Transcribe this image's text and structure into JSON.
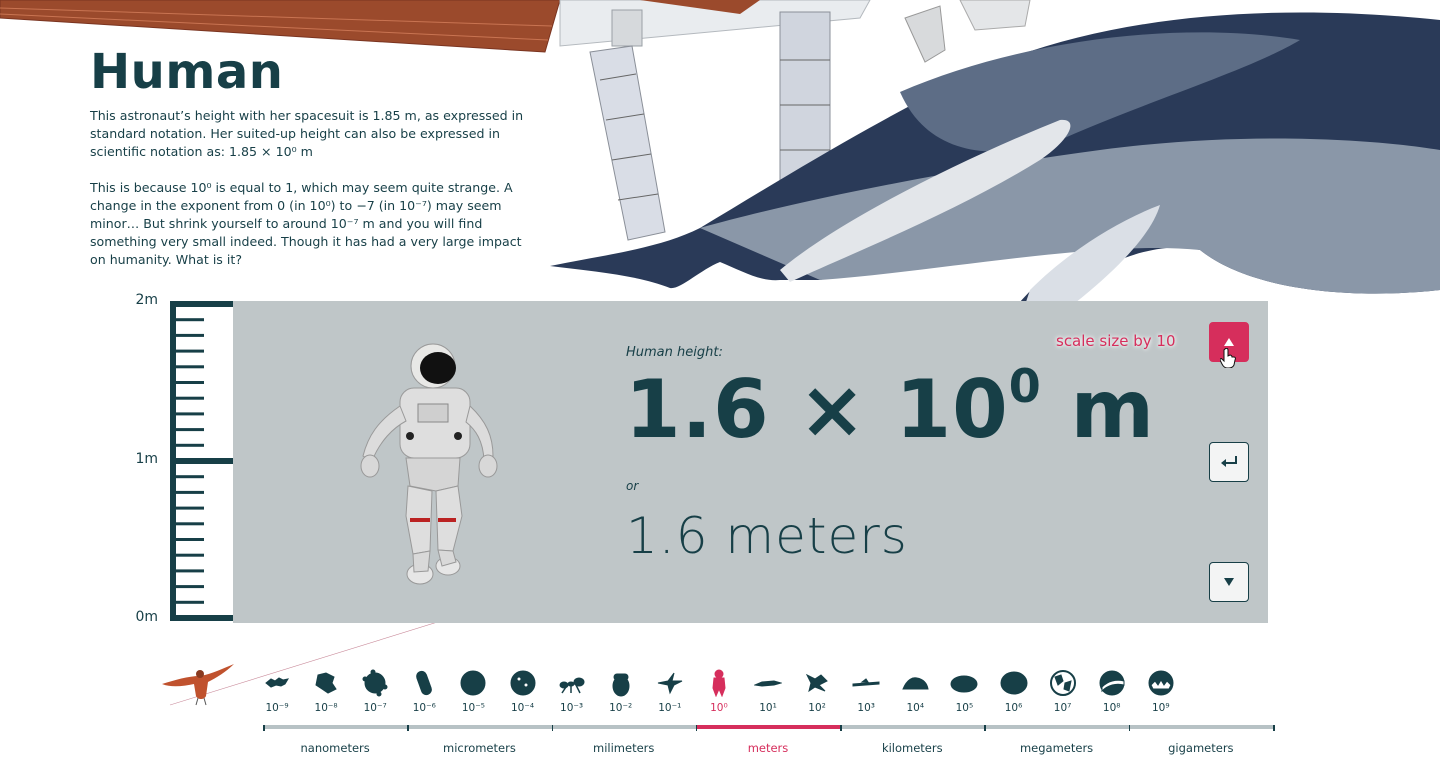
{
  "page": {
    "title": "Human",
    "intro_paragraphs": [
      "This astronaut’s height with her spacesuit is 1.85 m, as expressed in standard notation. Her suited-up height can also be expressed in scientific notation as: 1.85 × 10⁰ m",
      "This is because 10⁰ is equal to 1, which may seem quite strange. A change in the exponent from 0 (in 10⁰) to −7 (in 10⁻⁷) may seem minor… But shrink yourself to around 10⁻⁷ m and you will find something very small indeed. Though it has had a very large impact on humanity. What is it?"
    ]
  },
  "ruler": {
    "labels": [
      "2m",
      "1m",
      "0m"
    ]
  },
  "panel": {
    "caption": "Human height:",
    "sci_mantissa": "1.6 × 10",
    "sci_exponent": "0",
    "sci_unit": " m",
    "or_label": "or",
    "plain_value": "1.6 meters",
    "scale_hint": "scale size by 10",
    "buttons": {
      "up_icon": "triangle-up-icon",
      "back_icon": "return-arrow-icon",
      "down_icon": "triangle-down-icon"
    }
  },
  "scale_steps": [
    {
      "label": "10⁻⁹",
      "icon": "virus-icon"
    },
    {
      "label": "10⁻⁸",
      "icon": "protein-icon"
    },
    {
      "label": "10⁻⁷",
      "icon": "virus-particle-icon"
    },
    {
      "label": "10⁻⁶",
      "icon": "bacterium-icon"
    },
    {
      "label": "10⁻⁵",
      "icon": "cell-icon"
    },
    {
      "label": "10⁻⁴",
      "icon": "pollen-icon"
    },
    {
      "label": "10⁻³",
      "icon": "ant-icon"
    },
    {
      "label": "10⁻²",
      "icon": "acorn-icon"
    },
    {
      "label": "10⁻¹",
      "icon": "bird-icon"
    },
    {
      "label": "10⁰",
      "icon": "astronaut-icon",
      "active": true
    },
    {
      "label": "10¹",
      "icon": "whale-icon"
    },
    {
      "label": "10²",
      "icon": "space-station-icon"
    },
    {
      "label": "10³",
      "icon": "airplane-icon"
    },
    {
      "label": "10⁴",
      "icon": "mountain-icon"
    },
    {
      "label": "10⁵",
      "icon": "island-icon"
    },
    {
      "label": "10⁶",
      "icon": "moon-icon"
    },
    {
      "label": "10⁷",
      "icon": "earth-icon"
    },
    {
      "label": "10⁸",
      "icon": "planet-icon"
    },
    {
      "label": "10⁹",
      "icon": "sun-icon"
    }
  ],
  "units": [
    {
      "label": "nanometers"
    },
    {
      "label": "micrometers"
    },
    {
      "label": "milimeters"
    },
    {
      "label": "meters",
      "active": true
    },
    {
      "label": "kilometers"
    },
    {
      "label": "megameters"
    },
    {
      "label": "gigameters"
    }
  ],
  "colors": {
    "accent": "#d62e5c",
    "ink": "#173f47",
    "panel": "#bfc6c8",
    "track": "#b7c2c5"
  }
}
